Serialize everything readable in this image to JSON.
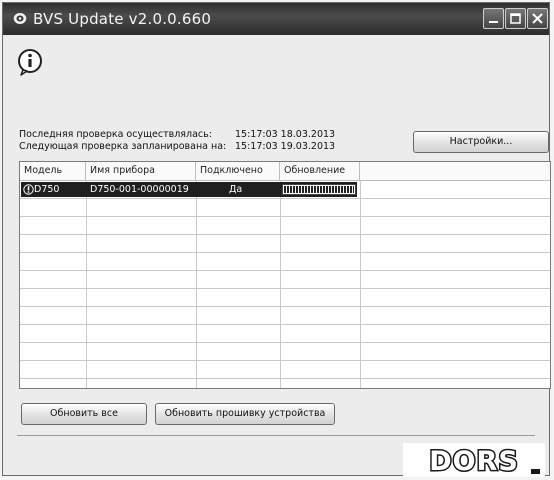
{
  "window": {
    "title": "BVS Update v2.0.0.660"
  },
  "status": {
    "last_check_label": "Последняя проверка осуществлялась:",
    "last_check_value": "15:17:03 18.03.2013",
    "next_check_label": "Следующая проверка запланирована на:",
    "next_check_value": "15:17:03 19.03.2013"
  },
  "buttons": {
    "settings": "Настройки...",
    "refresh_all": "Обновить все",
    "update_firmware": "Обновить прошивку устройства"
  },
  "table": {
    "columns": [
      "Модель",
      "Имя прибора",
      "Подключено",
      "Обновление"
    ],
    "rows": [
      {
        "model": "D750",
        "name": "D750-001-00000019",
        "connected": "Да",
        "update_progress": 1.0,
        "status_icon": "warning-icon"
      }
    ]
  },
  "logo": {
    "text": "DORS"
  },
  "colors": {
    "titlebar": "#3a3a3a",
    "selection": "#1f1f1f",
    "window_bg": "#ececec"
  }
}
